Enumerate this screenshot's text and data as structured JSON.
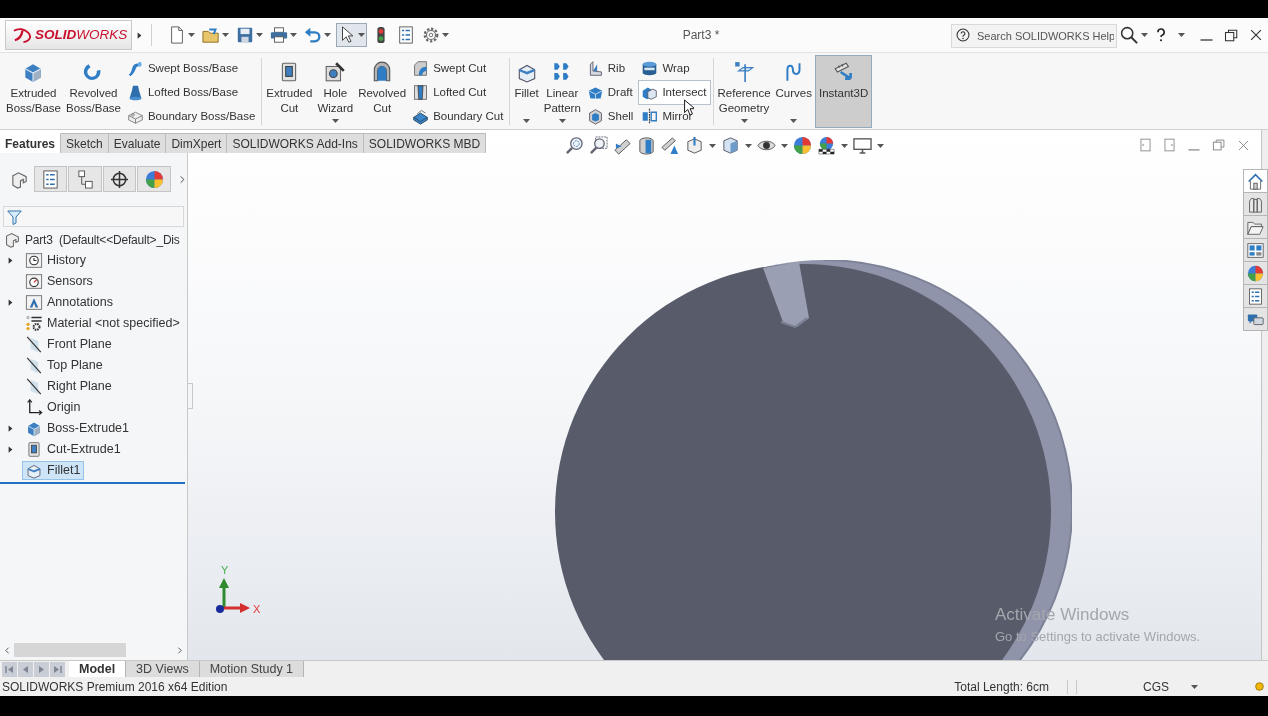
{
  "title_bar": {
    "logo": "**SOLID**WORKS",
    "title": "Part3 *",
    "search": {
      "placeholder": "Search SOLIDWORKS Help"
    }
  },
  "quick_access": [
    {
      "selected": false
    },
    {
      "selected": false
    },
    {
      "selected": false
    },
    {
      "selected": false
    },
    {
      "selected": false
    },
    {
      "selected": true
    },
    {
      "selected": false
    },
    {
      "selected": false
    },
    {
      "selected": false
    }
  ],
  "ribbon": {
    "groups": [
      {
        "items": [
          {
            "kind": "large",
            "label": "Extruded Boss/Base",
            "dropdown": false,
            "selected": false
          },
          {
            "kind": "large",
            "label": "Revolved Boss/Base",
            "dropdown": false,
            "selected": false
          },
          {
            "kind": "stack",
            "buttons": [
              {
                "label": "Swept Boss/Base",
                "hovered": false
              },
              {
                "label": "Lofted Boss/Base",
                "hovered": false
              },
              {
                "label": "Boundary Boss/Base",
                "hovered": false
              }
            ]
          }
        ]
      },
      {
        "items": [
          {
            "kind": "large",
            "label": "Extruded Cut",
            "dropdown": false,
            "selected": false
          },
          {
            "kind": "large",
            "label": "Hole Wizard",
            "dropdown": true,
            "selected": false
          },
          {
            "kind": "large",
            "label": "Revolved Cut",
            "dropdown": false,
            "selected": false
          },
          {
            "kind": "stack",
            "buttons": [
              {
                "label": "Swept Cut",
                "hovered": false
              },
              {
                "label": "Lofted Cut",
                "hovered": false
              },
              {
                "label": "Boundary Cut",
                "hovered": false
              }
            ]
          }
        ]
      },
      {
        "items": [
          {
            "kind": "large",
            "label": "Fillet",
            "dropdown": true,
            "selected": false
          },
          {
            "kind": "large",
            "label": "Linear Pattern",
            "dropdown": true,
            "selected": false
          },
          {
            "kind": "stack",
            "buttons": [
              {
                "label": "Rib",
                "hovered": false
              },
              {
                "label": "Draft",
                "hovered": false
              },
              {
                "label": "Shell",
                "hovered": false
              }
            ]
          },
          {
            "kind": "stack",
            "buttons": [
              {
                "label": "Wrap",
                "hovered": false
              },
              {
                "label": "Intersect",
                "hovered": true
              },
              {
                "label": "Mirror",
                "hovered": false
              }
            ]
          }
        ]
      },
      {
        "items": [
          {
            "kind": "large",
            "label": "Reference Geometry",
            "dropdown": true,
            "selected": false
          },
          {
            "kind": "large",
            "label": "Curves",
            "dropdown": true,
            "selected": false
          },
          {
            "kind": "large",
            "label": "Instant3D",
            "dropdown": false,
            "selected": true
          }
        ]
      }
    ]
  },
  "command_tabs": [
    {
      "label": "Features",
      "selected": true
    },
    {
      "label": "Sketch",
      "selected": false
    },
    {
      "label": "Evaluate",
      "selected": false
    },
    {
      "label": "DimXpert",
      "selected": false
    },
    {
      "label": "SOLIDWORKS Add-Ins",
      "selected": false
    },
    {
      "label": "SOLIDWORKS MBD",
      "selected": false
    }
  ],
  "feature_manager": {
    "panel_tabs": [
      {
        "selected": true
      },
      {
        "selected": false
      },
      {
        "selected": false
      },
      {
        "selected": false
      },
      {
        "selected": false
      }
    ],
    "tree": {
      "label": "Part3  (Default<<Default>_Dis",
      "children": [
        {
          "label": "History",
          "expandable": true,
          "selected": false
        },
        {
          "label": "Sensors",
          "expandable": false,
          "selected": false
        },
        {
          "label": "Annotations",
          "expandable": true,
          "selected": false
        },
        {
          "label": "Material <not specified>",
          "expandable": false,
          "selected": false
        },
        {
          "label": "Front Plane",
          "expandable": false,
          "selected": false
        },
        {
          "label": "Top Plane",
          "expandable": false,
          "selected": false
        },
        {
          "label": "Right Plane",
          "expandable": false,
          "selected": false
        },
        {
          "label": "Origin",
          "expandable": false,
          "selected": false
        },
        {
          "label": "Boss-Extrude1",
          "expandable": true,
          "selected": false
        },
        {
          "label": "Cut-Extrude1",
          "expandable": true,
          "selected": false
        },
        {
          "label": "Fillet1",
          "expandable": false,
          "selected": true
        }
      ]
    }
  },
  "viewport": {
    "triad": {
      "y_label": "Y",
      "x_label": "X"
    },
    "os_notice": {
      "title": "Activate Windows",
      "text": "Go to Settings to activate Windows."
    }
  },
  "task_pane": [
    {
      "selected": true
    },
    {
      "selected": false
    },
    {
      "selected": false
    },
    {
      "selected": false
    },
    {
      "selected": false
    },
    {
      "selected": false
    },
    {
      "selected": false
    }
  ],
  "bottom_tabs": [
    {
      "label": "Model",
      "selected": true
    },
    {
      "label": "3D Views",
      "selected": false
    },
    {
      "label": "Motion Study 1",
      "selected": false
    }
  ],
  "status_bar": {
    "edition": "SOLIDWORKS Premium 2016 x64 Edition",
    "measurement": "Total Length: 6cm",
    "units": "CGS"
  }
}
